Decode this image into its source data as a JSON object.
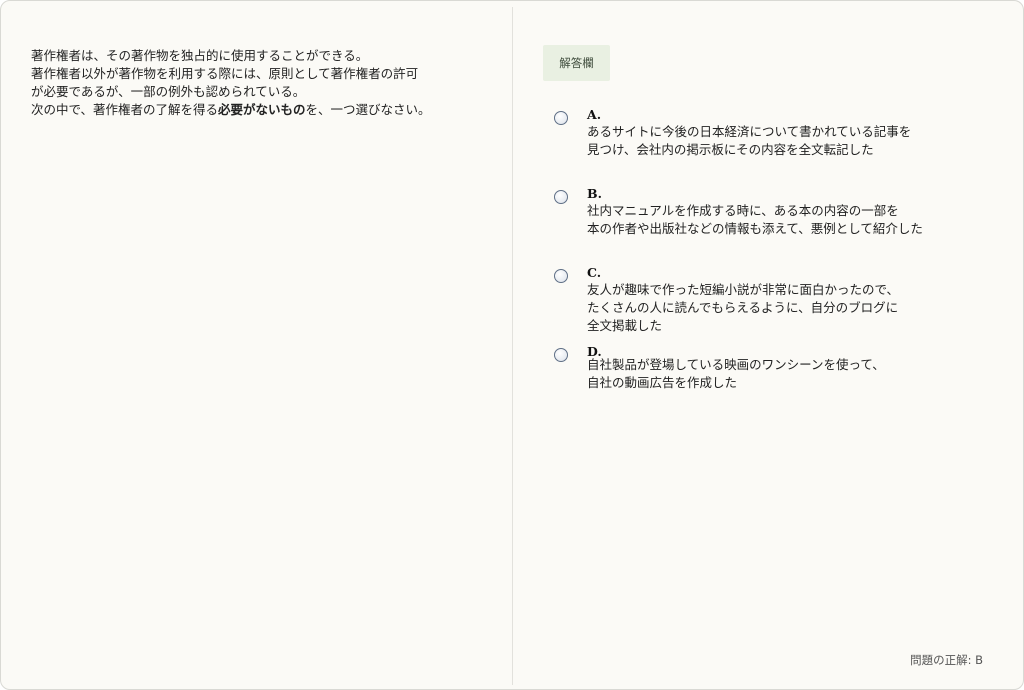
{
  "question": {
    "lines": [
      "著作権者は、その著作物を独占的に使用することができる。",
      "著作権者以外が著作物を利用する際には、原則として著作権者の許可",
      "が必要であるが、一部の例外も認められている。"
    ],
    "last_line_before": "次の中で、著作権者の了解を得る",
    "last_line_bold": "必要がないもの",
    "last_line_after": "を、一つ選びなさい。"
  },
  "answer_tab": {
    "label": "解答欄"
  },
  "options": [
    {
      "label": "A.",
      "lines": [
        "あるサイトに今後の日本経済について書かれている記事を",
        "見つけ、会社内の掲示板にその内容を全文転記した"
      ]
    },
    {
      "label": "B.",
      "lines": [
        "社内マニュアルを作成する時に、ある本の内容の一部を",
        "本の作者や出版社などの情報も添えて、悪例として紹介した"
      ]
    },
    {
      "label": "C.",
      "lines": [
        "友人が趣味で作った短編小説が非常に面白かったので、",
        "たくさんの人に読んでもらえるように、自分のブログに",
        "全文掲載した"
      ]
    },
    {
      "label": "D.",
      "lines": [
        "自社製品が登場している映画のワンシーンを使って、",
        "自社の動画広告を作成した"
      ]
    }
  ],
  "footer": {
    "correct_answer": "問題の正解: B"
  }
}
